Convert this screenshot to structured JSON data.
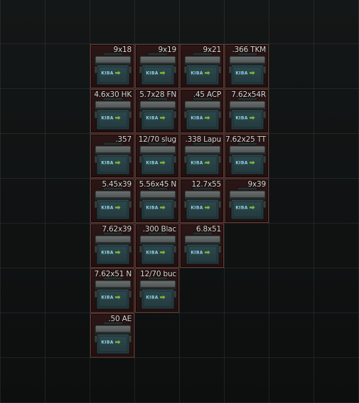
{
  "stash": {
    "columns": 8,
    "rows": 9,
    "items": [
      {
        "label": "9x18",
        "col": 2,
        "row": 1,
        "icon": "ammo-box-icon"
      },
      {
        "label": "9x19",
        "col": 3,
        "row": 1,
        "icon": "ammo-box-icon"
      },
      {
        "label": "9x21",
        "col": 4,
        "row": 1,
        "icon": "ammo-box-icon"
      },
      {
        "label": ".366 TKM",
        "col": 5,
        "row": 1,
        "icon": "ammo-box-icon"
      },
      {
        "label": "4.6x30 HK",
        "col": 2,
        "row": 2,
        "icon": "ammo-box-icon"
      },
      {
        "label": "5.7x28 FN",
        "col": 3,
        "row": 2,
        "icon": "ammo-box-icon"
      },
      {
        "label": ".45 ACP",
        "col": 4,
        "row": 2,
        "icon": "ammo-box-icon"
      },
      {
        "label": "7.62x54R",
        "col": 5,
        "row": 2,
        "icon": "ammo-box-icon"
      },
      {
        "label": ".357",
        "col": 2,
        "row": 3,
        "icon": "ammo-box-icon"
      },
      {
        "label": "12/70 slug",
        "col": 3,
        "row": 3,
        "icon": "ammo-box-icon"
      },
      {
        "label": ".338 Lapu",
        "col": 4,
        "row": 3,
        "icon": "ammo-box-icon"
      },
      {
        "label": "7.62x25 TT",
        "col": 5,
        "row": 3,
        "icon": "ammo-box-icon"
      },
      {
        "label": "5.45x39",
        "col": 2,
        "row": 4,
        "icon": "ammo-box-icon"
      },
      {
        "label": "5.56x45 N",
        "col": 3,
        "row": 4,
        "icon": "ammo-box-icon"
      },
      {
        "label": "12.7x55",
        "col": 4,
        "row": 4,
        "icon": "ammo-box-icon"
      },
      {
        "label": "9x39",
        "col": 5,
        "row": 4,
        "icon": "ammo-box-icon"
      },
      {
        "label": "7.62x39",
        "col": 2,
        "row": 5,
        "icon": "ammo-box-icon"
      },
      {
        "label": ".300 Blac",
        "col": 3,
        "row": 5,
        "icon": "ammo-box-icon"
      },
      {
        "label": "6.8x51",
        "col": 4,
        "row": 5,
        "icon": "ammo-box-icon"
      },
      {
        "label": "7.62x51 N",
        "col": 2,
        "row": 6,
        "icon": "ammo-box-icon"
      },
      {
        "label": "12/70 buc",
        "col": 3,
        "row": 6,
        "icon": "ammo-box-icon"
      },
      {
        "label": ".50 AE",
        "col": 2,
        "row": 7,
        "icon": "ammo-box-icon"
      }
    ],
    "box_brand": "KIBA",
    "colors": {
      "item_background": "#2b1616",
      "item_border": "#6a3a33",
      "box_body": "#23393d",
      "box_lid": "#4b4f4f",
      "brand_text": "#8fd3e0",
      "brand_arrow": "#7fb83a",
      "label_text": "#d9dcd7"
    }
  }
}
